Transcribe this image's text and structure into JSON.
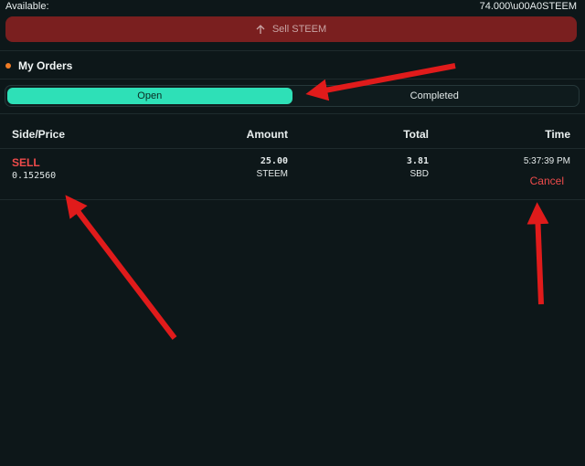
{
  "available": {
    "label": "Available:",
    "value": "74.000\\u00A0STEEM"
  },
  "sell_button": {
    "label": "Sell STEEM",
    "icon": "arrow-up-icon"
  },
  "orders": {
    "title": "My Orders",
    "tabs": [
      {
        "label": "Open",
        "active": true
      },
      {
        "label": "Completed",
        "active": false
      }
    ],
    "columns": [
      "Side/Price",
      "Amount",
      "Total",
      "Time"
    ],
    "rows": [
      {
        "side": "SELL",
        "price": "0.152560",
        "amount": "25.00",
        "amount_unit": "STEEM",
        "total": "3.81",
        "total_unit": "SBD",
        "time": "5:37:39 PM",
        "action": "Cancel"
      }
    ]
  },
  "colors": {
    "accent": "#2ee0b7",
    "sell": "#ee4b4b",
    "sell_button_bg": "#7a1f1f",
    "dot": "#f07c25",
    "annotation_arrow": "#e01b1b"
  }
}
